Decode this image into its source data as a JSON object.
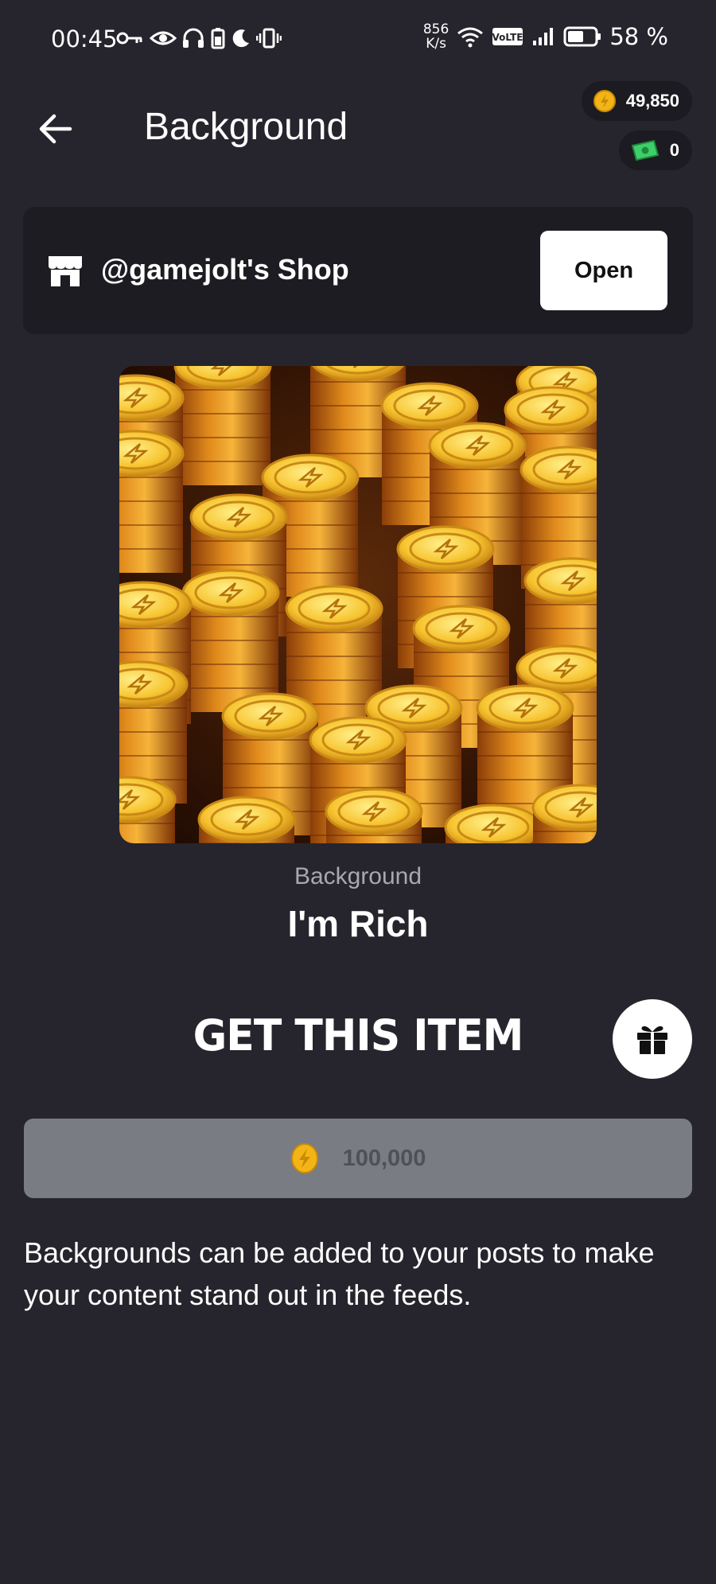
{
  "status_bar": {
    "time": "00:45",
    "net_speed_value": "856",
    "net_speed_unit": "K/s",
    "battery": "58 %",
    "icons": [
      "key-icon",
      "eye-icon",
      "headphones-icon",
      "battery-saver-icon",
      "moon-icon",
      "vibrate-icon",
      "wifi-icon",
      "volte-icon",
      "signal-icon",
      "battery-icon"
    ]
  },
  "header": {
    "title": "Background",
    "back_icon": "back-arrow-icon"
  },
  "currencies": {
    "coins": "49,850",
    "cash": "0"
  },
  "shop": {
    "name": "@gamejolt's Shop",
    "open_label": "Open",
    "icon": "store-icon"
  },
  "item": {
    "kind": "Background",
    "name": "I'm Rich"
  },
  "purchase": {
    "heading": "GET THIS ITEM",
    "price": "100,000",
    "gift_icon": "gift-icon"
  },
  "description": "Backgrounds can be added to your posts to make your content stand out in the feeds.",
  "colors": {
    "background": "#26252d",
    "card": "#1d1c22",
    "coin": "#f3b417",
    "buy_button": "#7a7c83"
  }
}
